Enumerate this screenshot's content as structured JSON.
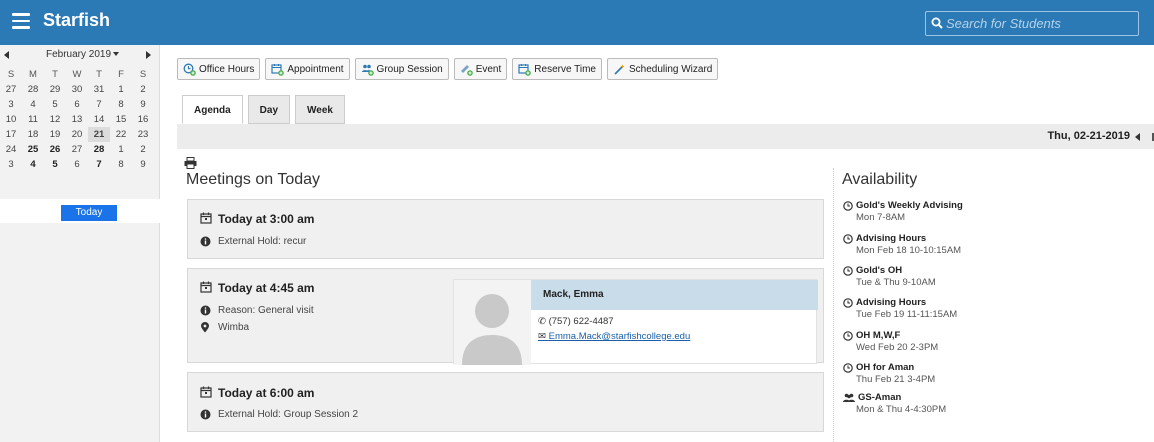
{
  "header": {
    "app_title": "Starfish",
    "search_placeholder": "Search for Students",
    "accent_color": "#2c7ab5"
  },
  "calendar": {
    "month_label": "February 2019",
    "weekdays": [
      "S",
      "M",
      "T",
      "W",
      "T",
      "F",
      "S"
    ],
    "weeks": [
      [
        "27",
        "28",
        "29",
        "30",
        "31",
        "1",
        "2"
      ],
      [
        "3",
        "4",
        "5",
        "6",
        "7",
        "8",
        "9"
      ],
      [
        "10",
        "11",
        "12",
        "13",
        "14",
        "15",
        "16"
      ],
      [
        "17",
        "18",
        "19",
        "20",
        "21",
        "22",
        "23"
      ],
      [
        "24",
        "25",
        "26",
        "27",
        "28",
        "1",
        "2"
      ],
      [
        "3",
        "4",
        "5",
        "6",
        "7",
        "8",
        "9"
      ]
    ],
    "selected_day": "21",
    "today_label": "Today"
  },
  "toolbar": {
    "buttons": [
      {
        "label": "Office Hours",
        "icon": "clock-plus-icon"
      },
      {
        "label": "Appointment",
        "icon": "calendar-plus-icon"
      },
      {
        "label": "Group Session",
        "icon": "group-plus-icon"
      },
      {
        "label": "Event",
        "icon": "event-plus-icon"
      },
      {
        "label": "Reserve Time",
        "icon": "calendar-plus-icon"
      },
      {
        "label": "Scheduling Wizard",
        "icon": "wand-icon"
      }
    ]
  },
  "tabs": [
    "Agenda",
    "Day",
    "Week"
  ],
  "date_label": "Thu, 02-21-2019",
  "meetings": {
    "title": "Meetings on Today",
    "items": [
      {
        "time": "Today at 3:00 am",
        "detail": "External Hold: recur"
      },
      {
        "time": "Today at 4:45 am",
        "detail": "Reason: General visit",
        "location": "Wimba",
        "student": {
          "name": "Mack, Emma",
          "phone": "(757) 622-4487",
          "email": "Emma.Mack@starfishcollege.edu"
        }
      },
      {
        "time": "Today at 6:00 am",
        "detail": "External Hold: Group Session 2"
      }
    ]
  },
  "availability": {
    "title": "Availability",
    "items": [
      {
        "name": "Gold's Weekly Advising",
        "time": "Mon 7-8AM",
        "icon": "clock-icon"
      },
      {
        "name": "Advising Hours",
        "time": "Mon Feb 18 10-10:15AM",
        "icon": "clock-icon"
      },
      {
        "name": "Gold's OH",
        "time": "Tue & Thu 9-10AM",
        "icon": "clock-icon"
      },
      {
        "name": "Advising Hours",
        "time": "Tue Feb 19 11-11:15AM",
        "icon": "clock-icon"
      },
      {
        "name": "OH M,W,F",
        "time": "Wed Feb 20 2-3PM",
        "icon": "clock-icon"
      },
      {
        "name": "OH for Aman",
        "time": "Thu Feb 21 3-4PM",
        "icon": "clock-icon"
      },
      {
        "name": "GS-Aman",
        "time": "Mon & Thu 4-4:30PM",
        "icon": "group-icon"
      }
    ]
  }
}
